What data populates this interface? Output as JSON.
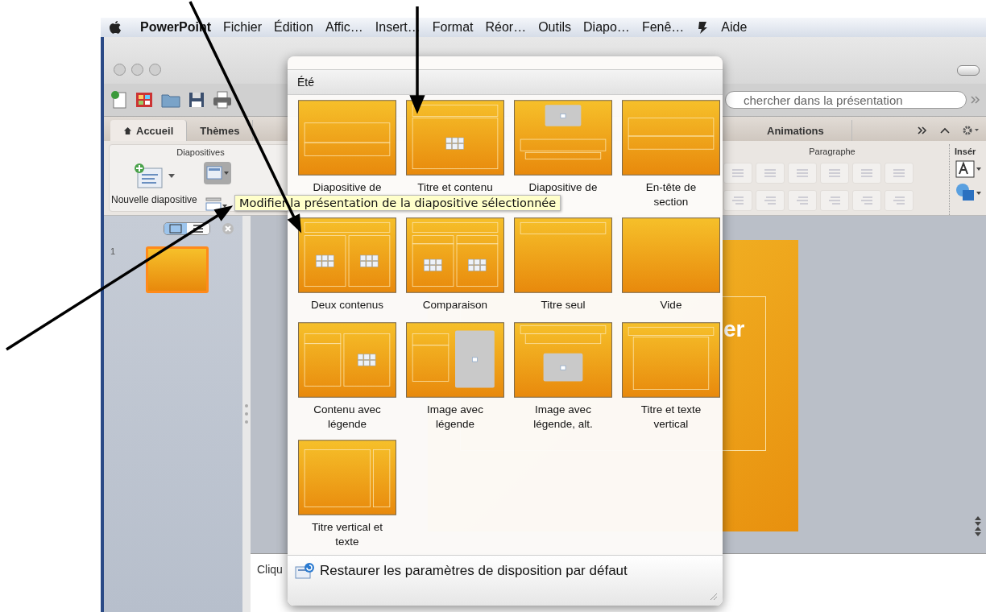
{
  "menu_bar": {
    "items": [
      {
        "label": "PowerPoint",
        "kind": "app"
      },
      {
        "label": "Fichier",
        "kind": "menu"
      },
      {
        "label": "Édition",
        "kind": "menu"
      },
      {
        "label": "Affic…",
        "kind": "menu"
      },
      {
        "label": "Insert…",
        "kind": "menu"
      },
      {
        "label": "Format",
        "kind": "menu"
      },
      {
        "label": "Réor…",
        "kind": "menu"
      },
      {
        "label": "Outils",
        "kind": "menu"
      },
      {
        "label": "Diapo…",
        "kind": "menu"
      },
      {
        "label": "Fenê…",
        "kind": "menu"
      },
      {
        "label": "Aide",
        "kind": "menu"
      }
    ]
  },
  "toolbar": {
    "search": {
      "placeholder": "chercher dans la présentation"
    }
  },
  "tabs": [
    {
      "label": "Accueil",
      "selected": true
    },
    {
      "label": "Thèmes",
      "selected": false
    },
    {
      "label": "Animations",
      "selected": false
    }
  ],
  "ribbon": {
    "groups": [
      {
        "title": "Diapositives"
      },
      {
        "title": "Paragraphe"
      },
      {
        "title": "Insér"
      }
    ],
    "new_slide_label": "Nouvelle diapositive"
  },
  "slides_panel": {
    "slides": [
      {
        "number": "1",
        "selected": true
      }
    ]
  },
  "slide": {
    "title": "er"
  },
  "notes": {
    "text": "Cliqu"
  },
  "tooltip": {
    "text": "Modifier la présentation de la diapositive sélectionnée"
  },
  "layout_gallery": {
    "title": "Été",
    "layouts": [
      {
        "kind": "title",
        "label": [
          "Diapositive de"
        ]
      },
      {
        "kind": "title-content",
        "label": [
          "Titre et contenu"
        ]
      },
      {
        "kind": "title-image",
        "label": [
          "Diapositive de"
        ]
      },
      {
        "kind": "section",
        "label": [
          "En-tête de",
          "section"
        ]
      },
      {
        "kind": "two-content",
        "label": [
          "Deux contenus"
        ]
      },
      {
        "kind": "comparison",
        "label": [
          "Comparaison"
        ]
      },
      {
        "kind": "title-only",
        "label": [
          "Titre seul"
        ]
      },
      {
        "kind": "blank",
        "label": [
          "Vide"
        ]
      },
      {
        "kind": "content-caption",
        "label": [
          "Contenu avec",
          "légende"
        ]
      },
      {
        "kind": "image-caption",
        "label": [
          "Image avec",
          "légende"
        ]
      },
      {
        "kind": "image-caption-alt",
        "label": [
          "Image avec",
          "légende, alt."
        ]
      },
      {
        "kind": "vertical-text",
        "label": [
          "Titre et texte",
          "vertical"
        ]
      },
      {
        "kind": "vertical-title",
        "label": [
          "Titre vertical et",
          "texte"
        ]
      }
    ],
    "restore_label": "Restaurer les paramètres de disposition par défaut"
  }
}
